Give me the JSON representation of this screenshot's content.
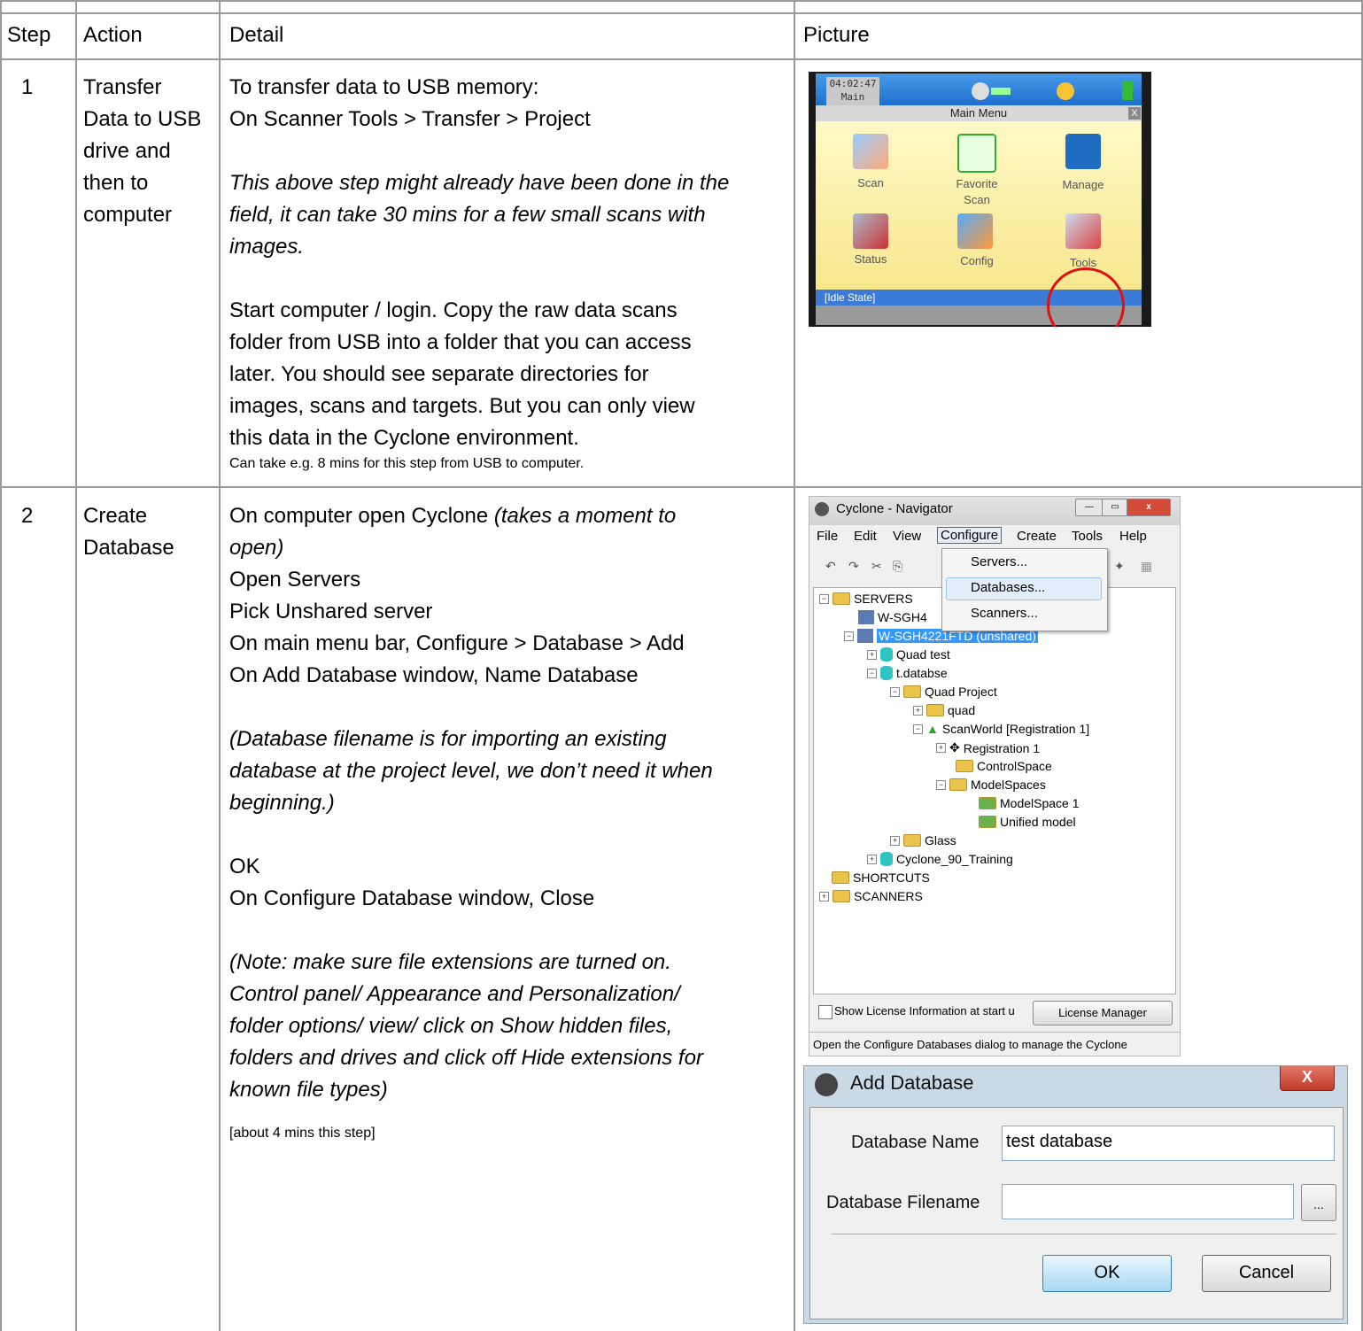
{
  "table": {
    "headers": {
      "step": "Step",
      "action": "Action",
      "detail": "Detail",
      "picture": "Picture"
    },
    "row1": {
      "step": "1",
      "action_lines": [
        "Transfer",
        "Data to USB",
        "drive and",
        "then to",
        "computer"
      ],
      "detail_lines": [
        "To transfer data to USB memory:",
        "On Scanner Tools > Transfer > Project"
      ],
      "detail_italic_lines": [
        "This above step might already have been done in the",
        "field, it can take 30 mins for a few small scans with",
        "images."
      ],
      "detail_lines2": [
        "Start computer / login. Copy the raw data scans",
        "folder from USB into a folder that you can access",
        "later. You should see separate directories for",
        "images, scans and targets. But you can only view",
        "this data in the Cyclone environment."
      ],
      "detail_small": "Can take e.g. 8 mins for this step from USB to computer."
    },
    "row2": {
      "step": "2",
      "action_lines": [
        "Create",
        "Database"
      ],
      "detail_line1_plain": "On computer open Cyclone ",
      "detail_line1_italic": "(takes a moment to",
      "detail_line2_italic": "open)",
      "detail_lines": [
        "Open Servers",
        "Pick Unshared server",
        "On main menu bar, Configure > Database > Add",
        "On Add Database window, Name Database"
      ],
      "detail_italic_lines": [
        "(Database filename is for importing an existing",
        "database at the project level, we don’t need it when",
        "beginning.)"
      ],
      "detail_lines2": [
        "OK",
        "On Configure Database window, Close"
      ],
      "detail_italic_lines2": [
        "(Note: make sure file extensions are turned on.",
        "Control panel/ Appearance and Personalization/",
        "folder options/ view/ click on Show hidden files,",
        "folders and drives and click off Hide extensions for",
        "known file types)"
      ],
      "detail_small": "[about 4 mins this step]"
    }
  },
  "scanner": {
    "clock": "04:02:47",
    "mode": "Main",
    "menu_title": "Main Menu",
    "close": "X",
    "icons": [
      {
        "label": "Scan"
      },
      {
        "label": "Favorite\nScan"
      },
      {
        "label": "Manage"
      },
      {
        "label": "Status"
      },
      {
        "label": "Config"
      },
      {
        "label": "Tools"
      }
    ],
    "state": "[Idle State]"
  },
  "navigator": {
    "title": "Cyclone - Navigator",
    "menu": [
      "File",
      "Edit",
      "View",
      "Configure",
      "Create",
      "Tools",
      "Help"
    ],
    "configure_menu": [
      "Servers...",
      "Databases...",
      "Scanners..."
    ],
    "tree": {
      "servers": "SERVERS",
      "server1": "W-SGH4",
      "server2": "W-SGH4221FTD (unshared)",
      "quad_test": "Quad test",
      "tdatabse": "t.databse",
      "quad_project": "Quad Project",
      "quad": "quad",
      "scanworld": "ScanWorld [Registration 1]",
      "registration": "Registration 1",
      "controlspace": "ControlSpace",
      "modelspaces": "ModelSpaces",
      "modelspace1": "ModelSpace 1",
      "unified": "Unified model",
      "glass": "Glass",
      "training": "Cyclone_90_Training",
      "shortcuts": "SHORTCUTS",
      "scanners": "SCANNERS"
    },
    "show_license": "Show License Information at start u",
    "license_manager": "License Manager",
    "status": "Open the Configure Databases dialog to manage the Cyclone"
  },
  "add_database": {
    "title": "Add Database",
    "close": "X",
    "name_label": "Database Name",
    "name_value": "test database",
    "filename_label": "Database Filename",
    "browse": "...",
    "ok": "OK",
    "cancel": "Cancel"
  }
}
